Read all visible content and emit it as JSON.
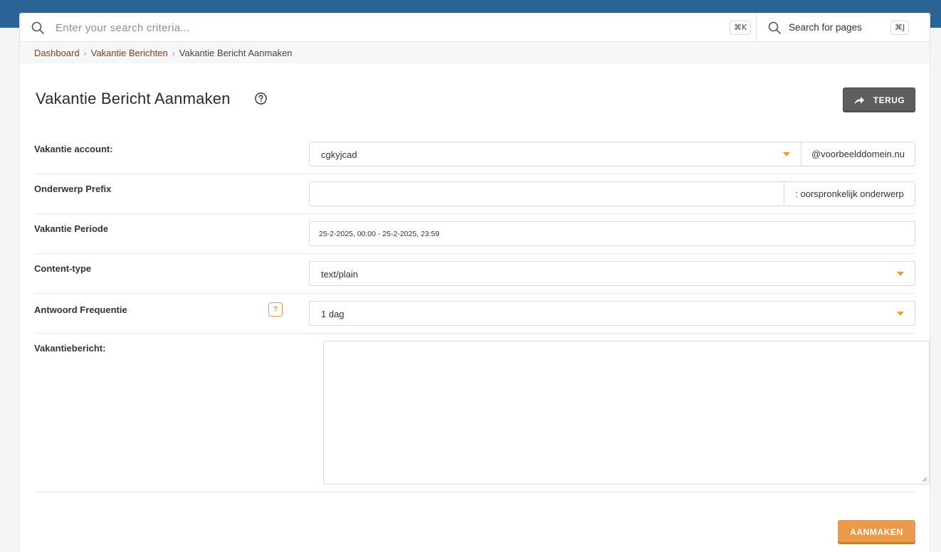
{
  "search": {
    "placeholder": "Enter your search criteria...",
    "shortcut": "⌘K",
    "pages_label": "Search for pages",
    "pages_shortcut": "⌘J"
  },
  "breadcrumb": {
    "items": [
      "Dashboard",
      "Vakantie Berichten"
    ],
    "current": "Vakantie Bericht Aanmaken"
  },
  "page": {
    "title": "Vakantie Bericht Aanmaken",
    "back_button": "TERUG"
  },
  "form": {
    "account": {
      "label": "Vakantie account:",
      "value": "cgkyjcad",
      "suffix": "@voorbeelddomein.nu"
    },
    "prefix": {
      "label": "Onderwerp Prefix",
      "value": "",
      "suffix": ": oorspronkelijk onderwerp"
    },
    "period": {
      "label": "Vakantie Periode",
      "value": "25-2-2025, 00:00 - 25-2-2025, 23:59"
    },
    "content_type": {
      "label": "Content-type",
      "value": "text/plain"
    },
    "frequency": {
      "label": "Antwoord Frequentie",
      "help": "?",
      "value": "1 dag"
    },
    "message": {
      "label": "Vakantiebericht:",
      "value": ""
    },
    "submit": "AANMAKEN"
  },
  "colors": {
    "header_blue": "#2a6496",
    "accent_orange": "#eb9a4c",
    "link_brown": "#7a4320",
    "back_button_gray": "#5e5e5e"
  }
}
